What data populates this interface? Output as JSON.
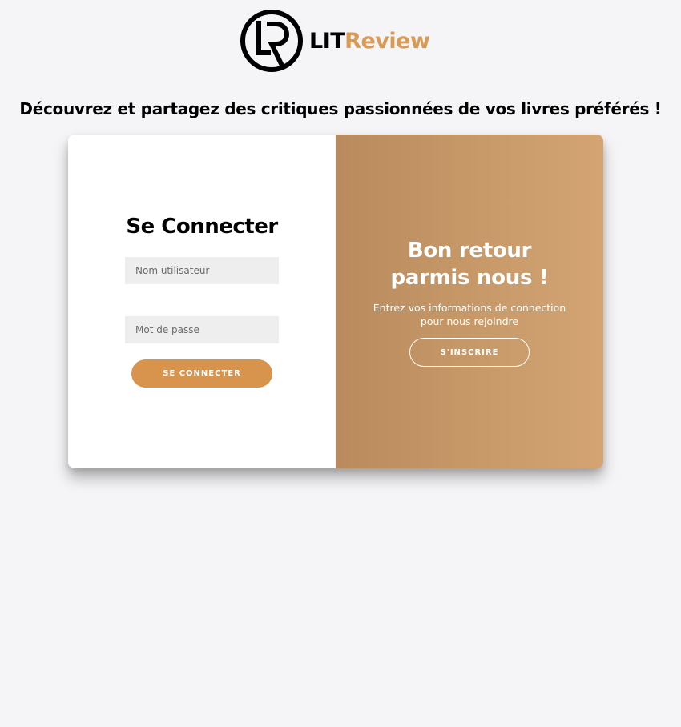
{
  "brand": {
    "logo_icon": "lr-monogram-icon",
    "name_part1": "LIT",
    "name_part2": "Review",
    "accent_color": "#d89a55"
  },
  "tagline": "Découvrez et partagez des critiques passionnées de vos livres préférés !",
  "login": {
    "title": "Se Connecter",
    "username_placeholder": "Nom utilisateur",
    "password_placeholder": "Mot de passe",
    "submit_label": "SE CONNECTER",
    "button_color": "#d8934d"
  },
  "welcome": {
    "title_line1": "Bon retour",
    "title_line2": "parmis nous !",
    "text_line1": "Entrez vos informations de connection",
    "text_line2": "pour nous rejoindre",
    "register_label": "S'INSCRIRE",
    "gradient_colors": [
      "#b98a5d",
      "#d4a473"
    ]
  }
}
